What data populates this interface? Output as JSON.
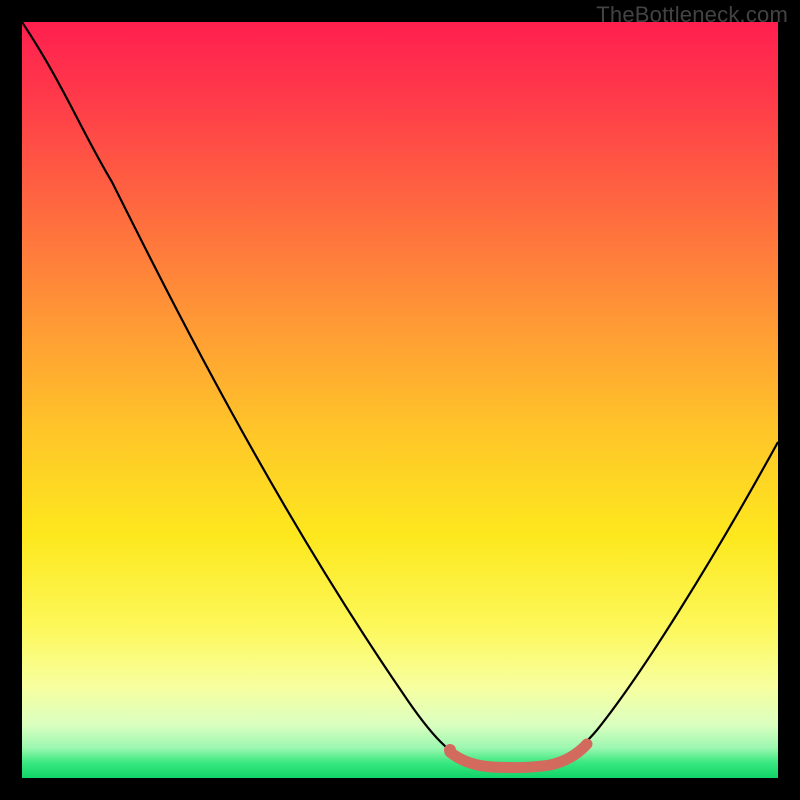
{
  "watermark": "TheBottleneck.com",
  "chart_data": {
    "type": "line",
    "title": "",
    "xlabel": "",
    "ylabel": "",
    "ylim": [
      0,
      100
    ],
    "xlim": [
      0,
      100
    ],
    "series": [
      {
        "name": "bottleneck-curve",
        "x": [
          0,
          6,
          12,
          18,
          24,
          30,
          36,
          42,
          48,
          54,
          57,
          60,
          63,
          66,
          70,
          74,
          80,
          86,
          92,
          100
        ],
        "values": [
          100,
          96,
          90,
          82,
          73,
          64,
          55,
          45,
          34,
          20,
          12,
          6,
          2,
          1,
          1,
          2,
          8,
          19,
          33,
          54
        ]
      }
    ],
    "highlight_segment": {
      "name": "optimal-range",
      "x": [
        57,
        60,
        63,
        66,
        70,
        74
      ],
      "values": [
        6,
        3,
        1,
        1,
        1,
        3
      ],
      "color": "#d36a5e"
    },
    "gradient_stops": [
      {
        "pos": 0,
        "color": "#ff1f4f"
      },
      {
        "pos": 25,
        "color": "#ff6a3f"
      },
      {
        "pos": 55,
        "color": "#ffc828"
      },
      {
        "pos": 80,
        "color": "#fdf85a"
      },
      {
        "pos": 96,
        "color": "#9cf7b0"
      },
      {
        "pos": 100,
        "color": "#10d468"
      }
    ]
  }
}
